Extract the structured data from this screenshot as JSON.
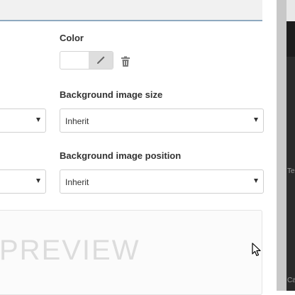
{
  "color": {
    "label": "Color",
    "picker_icon": "eyedropper-icon",
    "delete_icon": "trash-icon"
  },
  "bg_size": {
    "label": "Background image size",
    "value": "Inherit"
  },
  "bg_position": {
    "label": "Background image position",
    "value": "Inherit"
  },
  "preview": {
    "text": "PREVIEW"
  },
  "background_fragments": [
    "Te",
    "Ca"
  ],
  "colors": {
    "accent_border": "#8fa9c0",
    "text": "#333333",
    "preview_text": "#dcdcdc"
  }
}
